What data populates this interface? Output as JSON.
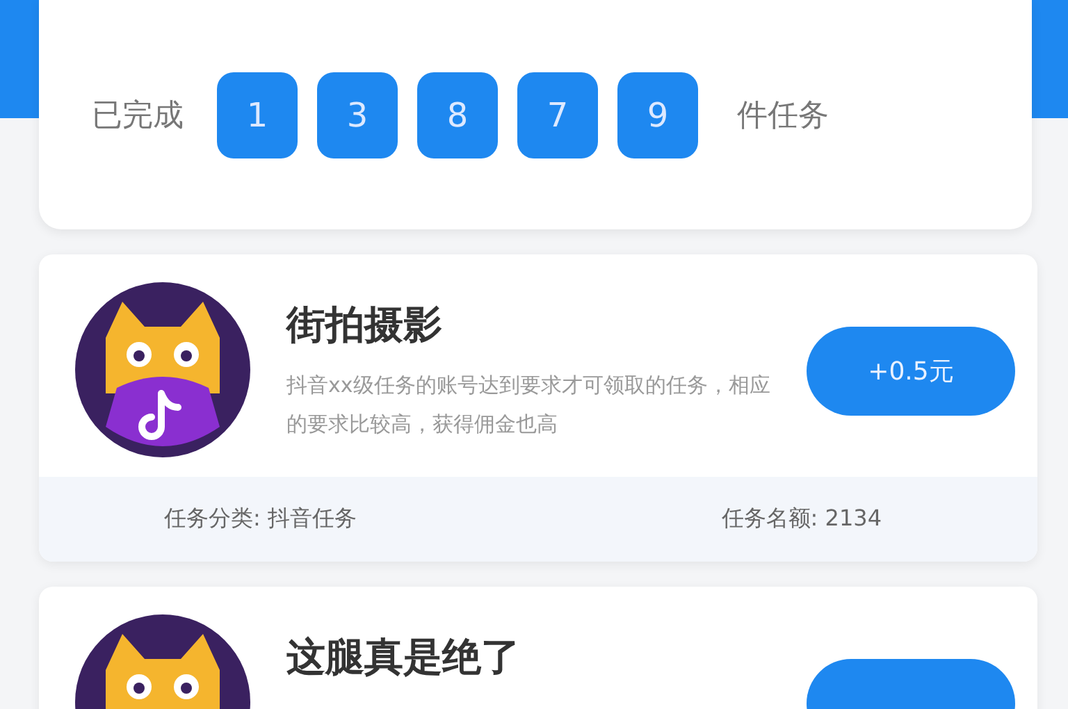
{
  "summary": {
    "prefix": "已完成",
    "digits": [
      "1",
      "3",
      "8",
      "7",
      "9"
    ],
    "suffix": "件任务"
  },
  "tasks": [
    {
      "title": "街拍摄影",
      "description": "抖音xx级任务的账号达到要求才可领取的任务，相应的要求比较高，获得佣金也高",
      "reward": "+0.5元",
      "category": "任务分类: 抖音任务",
      "quota": "任务名额: 2134"
    },
    {
      "title": "这腿真是绝了"
    }
  ]
}
